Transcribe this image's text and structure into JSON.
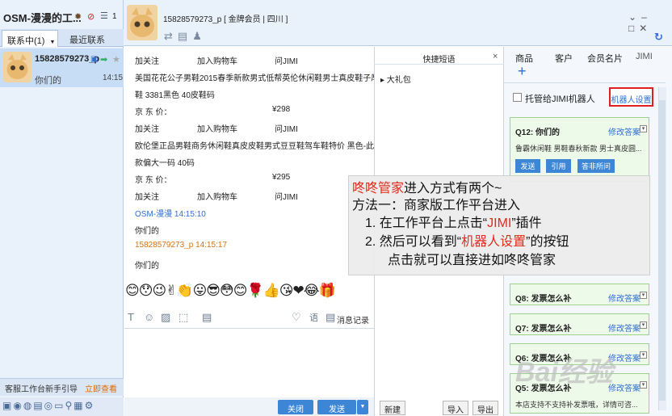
{
  "app": {
    "title": "OSM-漫漫的工...",
    "title_counter": "1",
    "tabs": [
      "联系中(1)",
      "最近联系"
    ],
    "tab_dropdown_arrow": "▼"
  },
  "contact": {
    "name": "15828579273_p",
    "subtitle": "你们的",
    "time": "14:15"
  },
  "guide": {
    "text": "客服工作台新手引导",
    "link": "立即查看"
  },
  "header": {
    "user": "15828579273_p",
    "meta": "[ 金牌会员 | 四川 ]"
  },
  "chat": {
    "messages": [
      {
        "actions": [
          "加关注",
          "加入购物车",
          "问JIMI"
        ]
      },
      {
        "text": "美国花花公子男鞋2015春季新款男式低帮英伦休闲鞋男士真皮鞋子厚底"
      },
      {
        "text": "鞋 3381黑色 40皮鞋码"
      },
      {
        "price_label": "京 东 价：",
        "price": "¥298"
      },
      {
        "actions": [
          "加关注",
          "加入购物车",
          "问JIMI"
        ]
      },
      {
        "text": "欧伦堡正品男鞋商务休闲鞋真皮皮鞋男式豆豆鞋驾车鞋特价 黑色-此"
      },
      {
        "text": "款偏大一码 40码"
      },
      {
        "price_label": "京 东 价：",
        "price": "¥295"
      },
      {
        "actions": [
          "加关注",
          "加入购物车",
          "问JIMI"
        ]
      },
      {
        "sender": "OSM-漫漫 14:15:10",
        "sender_color": "#2e6fcf"
      },
      {
        "text": "你们的"
      },
      {
        "sender": "15828579273_p 14:15:17",
        "sender_color": "#d7720f"
      },
      {
        "text": "你们的"
      }
    ],
    "emoji_row": "😊😯😉✌👏😛😎😳😊🌹👍😘❤😂🎁",
    "record_label": "消息记录",
    "close_button": "关闭",
    "send_button": "发送"
  },
  "quick": {
    "title": "快捷短语",
    "close": "×",
    "items": [
      "▸ 大礼包"
    ],
    "new_button": "新建",
    "import_button": "导入",
    "export_button": "导出"
  },
  "right": {
    "tabs": [
      "商品",
      "客户",
      "会员名片",
      "JIMI"
    ],
    "add_label": "+",
    "checkbox_label": "托管给JIMI机器人",
    "robot_button": "机器人设置",
    "edit_label": "修改答案",
    "cards": [
      {
        "q": "Q12: 你们的",
        "a": "鲁霸休闲鞋 男鞋春秋新款 男士真皮圆...",
        "buttons": [
          "发送",
          "引用",
          "答非所问"
        ]
      },
      {
        "q": "Q8: 发票怎么补",
        "a": ""
      },
      {
        "q": "Q7: 发票怎么补",
        "a": ""
      },
      {
        "q": "Q6: 发票怎么补",
        "a": ""
      },
      {
        "q": "Q5: 发票怎么补",
        "a": "本店支持不支持补发票哦，详情可咨..."
      }
    ]
  },
  "overlay": {
    "line1_red": "咚咚管家",
    "line1_rest": "进入方式有两个~",
    "line2": "方法一：商家版工作平台进入",
    "line3_pre": "1.  在工作平台上点击“",
    "line3_red": "JIMI",
    "line3_post": "”插件",
    "line4_pre": "2.  然后可以看到“",
    "line4_red": "机器人设置",
    "line4_post": "”的按钮",
    "line5": "点击就可以直接进如咚咚管家"
  },
  "colors": {
    "accent_blue": "#3d86d6",
    "highlight_red": "#e12a1b",
    "card_green": "#eefae9"
  }
}
